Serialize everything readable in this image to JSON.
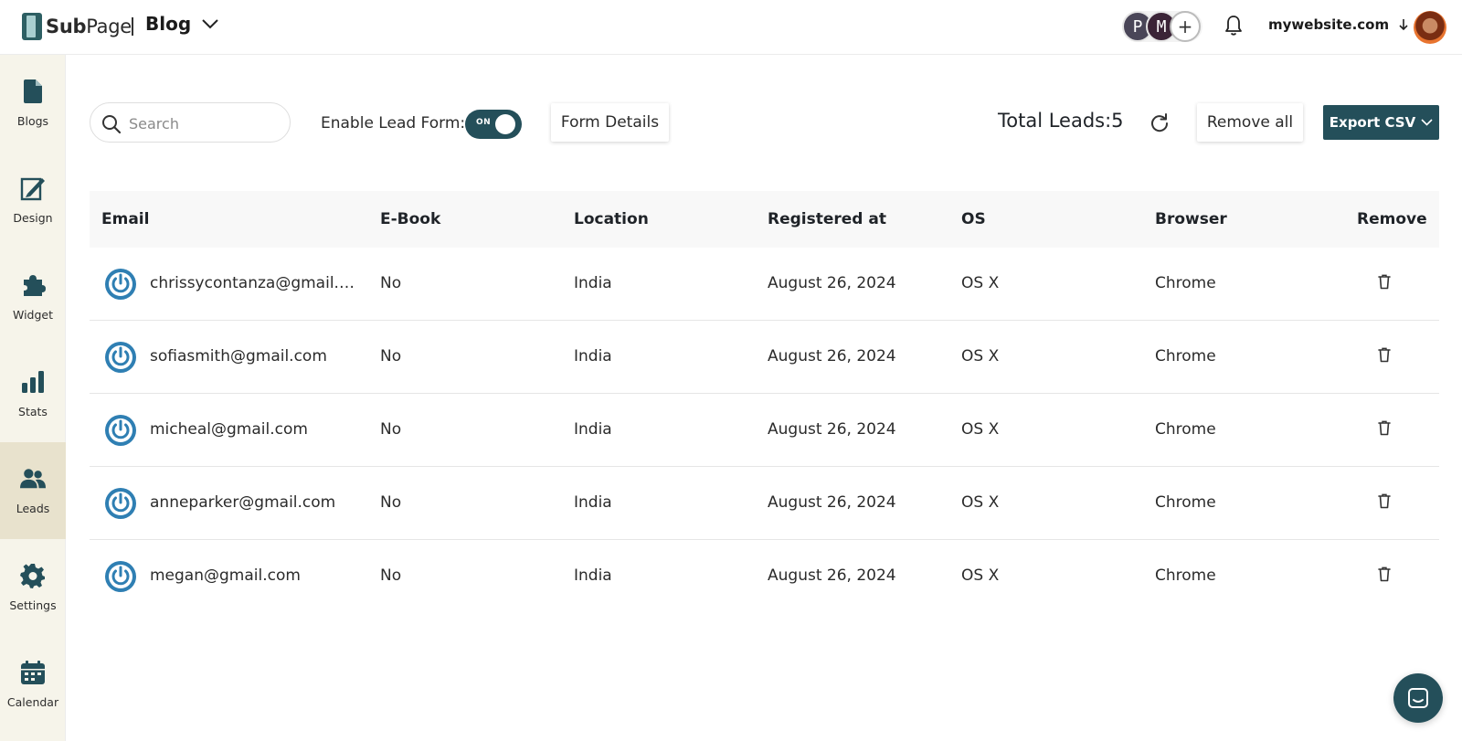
{
  "header": {
    "logo_text": "SubPage",
    "blog_label": "Blog",
    "collaborators": [
      "P",
      "M",
      "+"
    ],
    "site": "mywebsite.com"
  },
  "sidebar": {
    "items": [
      {
        "label": "Blogs",
        "icon": "document-icon"
      },
      {
        "label": "Design",
        "icon": "design-icon"
      },
      {
        "label": "Widget",
        "icon": "puzzle-icon"
      },
      {
        "label": "Stats",
        "icon": "bar-chart-icon"
      },
      {
        "label": "Leads",
        "icon": "users-icon",
        "active": true
      },
      {
        "label": "Settings",
        "icon": "gear-icon"
      },
      {
        "label": "Calendar",
        "icon": "calendar-icon"
      }
    ]
  },
  "toolbar": {
    "search_placeholder": "Search",
    "lead_form_label": "Enable Lead Form:",
    "toggle_label": "ON",
    "toggle_on": true,
    "form_details_label": "Form Details",
    "total_leads_label": "Total Leads:5",
    "remove_all_label": "Remove all",
    "export_label": "Export CSV"
  },
  "table": {
    "headers": [
      "Email",
      "E-Book",
      "Location",
      "Registered at",
      "OS",
      "Browser",
      "Remove"
    ],
    "rows": [
      {
        "email": "chrissycontanza@gmail.co...",
        "ebook": "No",
        "location": "India",
        "registered": "August 26, 2024",
        "os": "OS X",
        "browser": "Chrome"
      },
      {
        "email": "sofiasmith@gmail.com",
        "ebook": "No",
        "location": "India",
        "registered": "August 26, 2024",
        "os": "OS X",
        "browser": "Chrome"
      },
      {
        "email": "micheal@gmail.com",
        "ebook": "No",
        "location": "India",
        "registered": "August 26, 2024",
        "os": "OS X",
        "browser": "Chrome"
      },
      {
        "email": "anneparker@gmail.com",
        "ebook": "No",
        "location": "India",
        "registered": "August 26, 2024",
        "os": "OS X",
        "browser": "Chrome"
      },
      {
        "email": "megan@gmail.com",
        "ebook": "No",
        "location": "India",
        "registered": "August 26, 2024",
        "os": "OS X",
        "browser": "Chrome"
      }
    ]
  },
  "colors": {
    "accent": "#244f5a",
    "sidebar_bg": "#f6f4ea",
    "sidebar_active": "#e8e2cd",
    "lead_icon": "#2f7fb3"
  }
}
